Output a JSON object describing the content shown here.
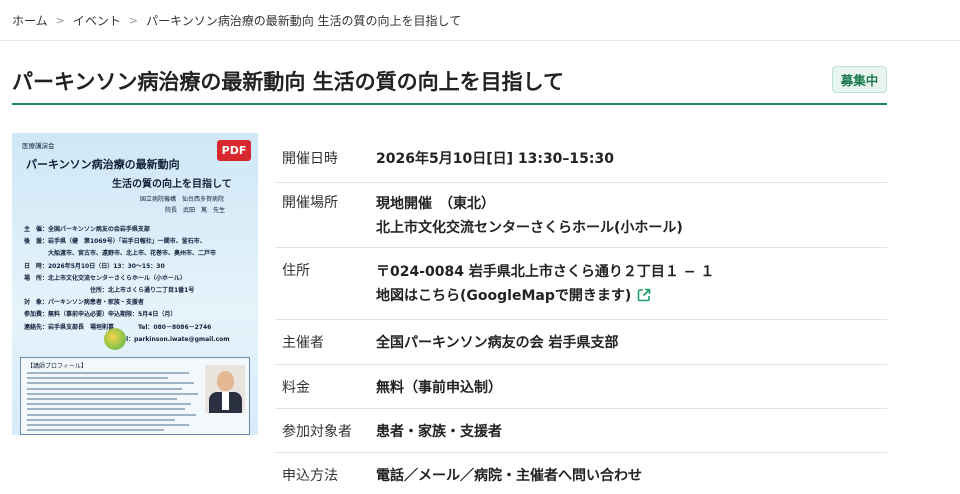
{
  "breadcrumb": {
    "items": [
      "ホーム",
      "イベント",
      "パーキンソン病治療の最新動向 生活の質の向上を目指して"
    ],
    "separator": ">"
  },
  "page": {
    "title": "パーキンソン病治療の最新動向 生活の質の向上を目指して",
    "status": "募集中"
  },
  "colors": {
    "accent": "#1a8a5e",
    "pdf": "#d9282f",
    "link_icon": "#1f9e6a"
  },
  "flyer": {
    "pdf_label": "PDF",
    "org": "医療講演会",
    "title_line1": "パーキンソン病治療の最新動向",
    "title_line2": "生活の質の向上を目指して",
    "speaker_affiliation": "国立病院機構　仙台西多賀病院",
    "speaker_name": "院長　武田　篤　先生",
    "details": "主　催：全国パーキンソン病友の会岩手県支部\n後　援：岩手県（健　第1069号）「岩手日報社」一関市、釜石市、\n　　　　大船渡市、宮古市、遠野市、北上市、花巻市、奥州市、二戸市\n日　時：2026年5月10日（日）13：30～15：30\n場　所：北上市文化交流センターさくらホール（小ホール）\n　　　　　　　　　　　住所：北上市さくら通り二丁目1番1号\n対　象：パーキンソン病患者・家族・支援者\n参加費：無料（事前申込必要）申込期限：5月4日（月）\n連絡先：岩手県支部長　場垣則喜　　　　Tel：080－8086－2746\n　　　　　　　　　　　　　　　Mail：parkinson.iwate@gmail.com",
    "profile_title": "【講師プロフィール】"
  },
  "info": [
    {
      "label": "開催日時",
      "lines": [
        "2026年5月10日[日] 13:30–15:30"
      ]
    },
    {
      "label": "開催場所",
      "lines": [
        "現地開催　（東北）",
        "北上市文化交流センターさくらホール(小ホール)"
      ]
    },
    {
      "label": "住所",
      "lines": [
        "〒024-0084 岩手県北上市さくら通り２丁目１ − １"
      ],
      "map_link": "地図はこちら(GoogleMapで開きます)",
      "map_icon": "external-link-icon"
    },
    {
      "label": "主催者",
      "lines": [
        "全国パーキンソン病友の会 岩手県支部"
      ]
    },
    {
      "label": "料金",
      "lines": [
        "無料（事前申込制）"
      ]
    },
    {
      "label": "参加対象者",
      "lines": [
        "患者・家族・支援者"
      ]
    },
    {
      "label": "申込方法",
      "lines": [
        "電話／メール／病院・主催者へ問い合わせ"
      ]
    }
  ]
}
